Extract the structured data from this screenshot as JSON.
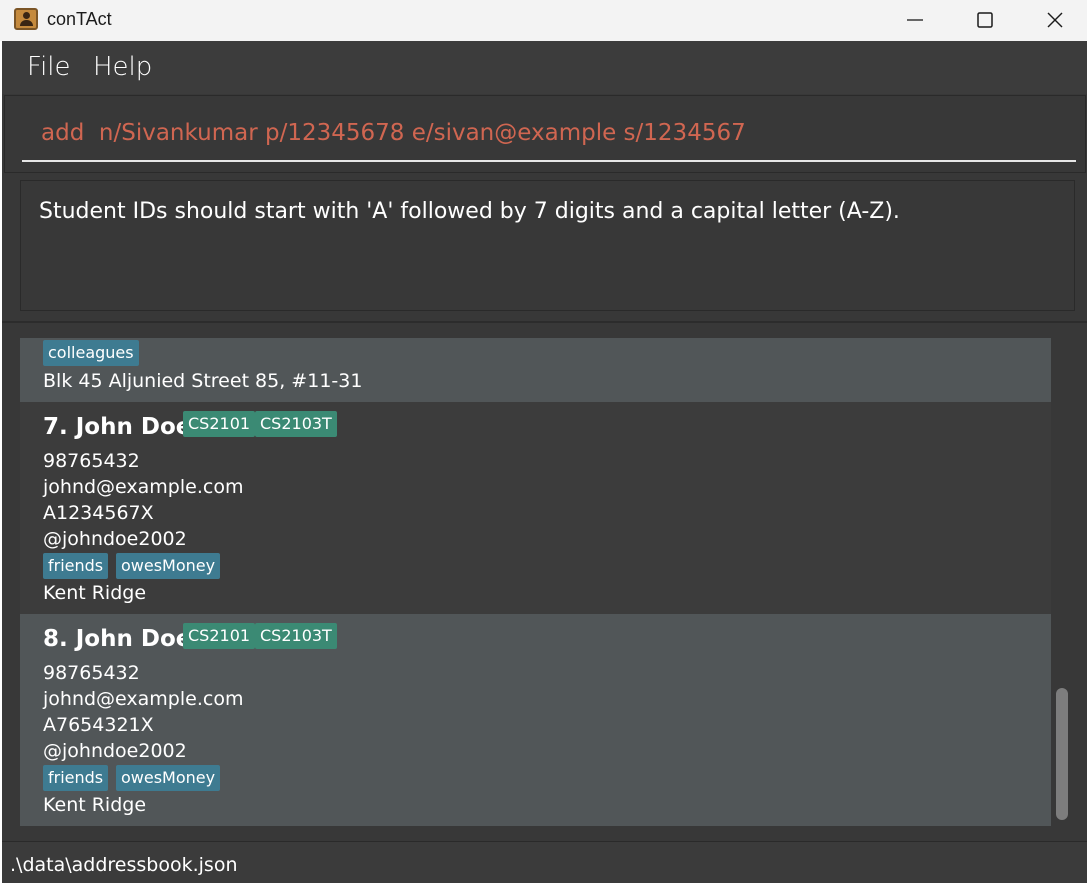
{
  "app": {
    "title": "conTAct"
  },
  "window_controls": {
    "minimize_icon": "minimize-icon",
    "maximize_icon": "maximize-icon",
    "close_icon": "close-icon"
  },
  "menu": {
    "items": [
      "File",
      "Help"
    ]
  },
  "command_box": {
    "value": "add  n/Sivankumar p/12345678 e/sivan@example s/1234567",
    "text_color": "#d06651"
  },
  "result_display": {
    "text": "Student IDs should start with 'A' followed by 7 digits and a capital letter (A-Z)."
  },
  "person_list": {
    "partial_card": {
      "tags": [
        "colleagues"
      ],
      "address": "Blk 45 Aljunied Street 85, #11-31"
    },
    "cards": [
      {
        "name": "7. John Doe",
        "modules": [
          "CS2101",
          "CS2103T"
        ],
        "phone": "98765432",
        "email": "johnd@example.com",
        "student_id": "A1234567X",
        "telegram": "@johndoe2002",
        "tags": [
          "friends",
          "owesMoney"
        ],
        "address": "Kent Ridge"
      },
      {
        "name": "8. John Doe",
        "modules": [
          "CS2101",
          "CS2103T"
        ],
        "phone": "98765432",
        "email": "johnd@example.com",
        "student_id": "A7654321X",
        "telegram": "@johndoe2002",
        "tags": [
          "friends",
          "owesMoney"
        ],
        "address": "Kent Ridge"
      }
    ]
  },
  "status_bar": {
    "file_path": ".\\data\\addressbook.json"
  },
  "colors": {
    "tag_blue": "#3e7b91",
    "module_green": "#3b8a74",
    "background": "#383838",
    "card_light": "#515658"
  }
}
